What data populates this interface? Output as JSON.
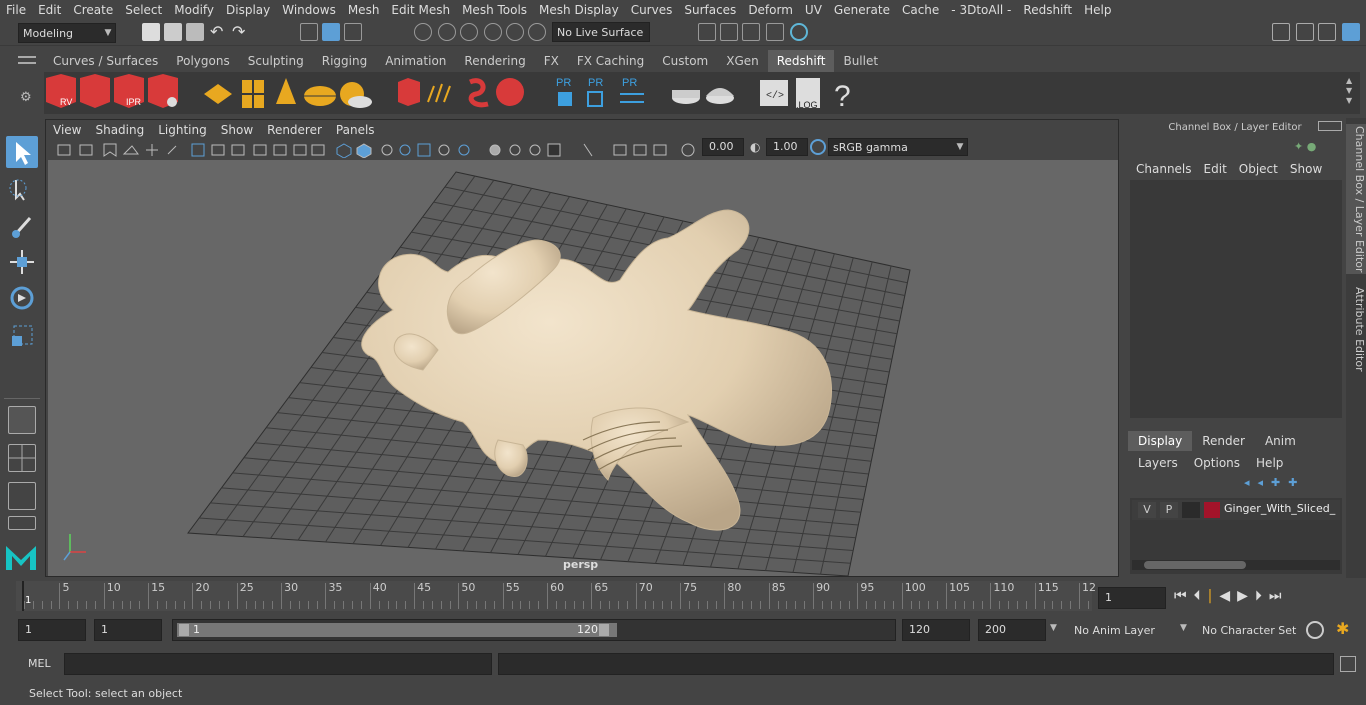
{
  "menubar": [
    "File",
    "Edit",
    "Create",
    "Select",
    "Modify",
    "Display",
    "Windows",
    "Mesh",
    "Edit Mesh",
    "Mesh Tools",
    "Mesh Display",
    "Curves",
    "Surfaces",
    "Deform",
    "UV",
    "Generate",
    "Cache",
    "- 3DtoAll -",
    "Redshift",
    "Help"
  ],
  "status": {
    "mode": "Modeling",
    "live_surface": "No Live Surface"
  },
  "shelf_tabs": [
    "Curves / Surfaces",
    "Polygons",
    "Sculpting",
    "Rigging",
    "Animation",
    "Rendering",
    "FX",
    "FX Caching",
    "Custom",
    "XGen",
    "Redshift",
    "Bullet"
  ],
  "shelf_active": "Redshift",
  "shelf_labels": {
    "rv": "RV",
    "ipr": "IPR",
    "pr1": "PR",
    "pr2": "PR",
    "pr3": "PR",
    "log": ".LOG",
    "help": "?"
  },
  "panel_menu": [
    "View",
    "Shading",
    "Lighting",
    "Show",
    "Renderer",
    "Panels"
  ],
  "panel_fields": {
    "exposure": "0.00",
    "gamma": "1.00",
    "colorspace": "sRGB gamma"
  },
  "viewport": {
    "camera": "persp"
  },
  "channel_box": {
    "title": "Channel Box / Layer Editor",
    "menu": [
      "Channels",
      "Edit",
      "Object",
      "Show"
    ]
  },
  "layer_editor": {
    "tabs": [
      "Display",
      "Render",
      "Anim"
    ],
    "active_tab": "Display",
    "menu": [
      "Layers",
      "Options",
      "Help"
    ],
    "layer": {
      "v": "V",
      "p": "P",
      "name": "Ginger_With_Sliced_Pa",
      "color": "#a3142a"
    }
  },
  "side_tabs": [
    "Channel Box / Layer Editor",
    "Attribute Editor"
  ],
  "timeline": {
    "ticks": [
      "5",
      "10",
      "15",
      "20",
      "25",
      "30",
      "35",
      "40",
      "45",
      "50",
      "55",
      "60",
      "65",
      "70",
      "75",
      "80",
      "85",
      "90",
      "95",
      "100",
      "105",
      "110",
      "115",
      "12"
    ],
    "start_label": "1",
    "current_frame": "1"
  },
  "range": {
    "start": "1",
    "playback_start": "1",
    "slider_start": "1",
    "slider_end": "120",
    "end": "120",
    "anim_end": "200",
    "anim_layer": "No Anim Layer",
    "char_set": "No Character Set"
  },
  "command": {
    "label": "MEL"
  },
  "help_line": "Select Tool: select an object",
  "colors": {
    "accent": "#5d9fd6",
    "redshift_red": "#d83a3a",
    "gold": "#e8a820"
  }
}
